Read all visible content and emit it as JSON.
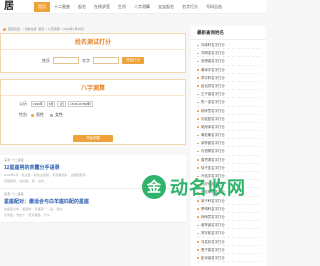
{
  "logo": {
    "text": "居"
  },
  "nav": {
    "items": [
      {
        "label": "首页",
        "active": true
      },
      {
        "label": "十二星座"
      },
      {
        "label": "起名"
      },
      {
        "label": "在线求签"
      },
      {
        "label": "生肖"
      },
      {
        "label": "八字测算"
      },
      {
        "label": "宝宝起名"
      },
      {
        "label": "名字打分"
      },
      {
        "label": "号码吉凶"
      }
    ]
  },
  "breadcrumb": {
    "label": "首页位置",
    "path": "> 当前位置: 首页 > 八字测算 > 2023年2月28日",
    "date": "2023年03月28日"
  },
  "name_test": {
    "title": "姓名测试打分",
    "surname_label": "姓氏",
    "name_label": "名字",
    "button": "开始打分"
  },
  "bazi": {
    "title": "八字测算",
    "date_label": "公历",
    "year": "1993年",
    "month": "5月",
    "day": "1日",
    "hour": "15:00-16:59(申)",
    "gender_label": "性别",
    "male": "男性",
    "female": "女性",
    "button": "开始测算"
  },
  "posts": [
    {
      "meta": "来源: 十二星座",
      "title": "12星座男的表露分手语录",
      "lines": [
        "2023年4月... 处女座... 和处女座相... 外观看起来... 这相知意思...",
        "巨蟹座男... 在外面... 我... 喜欢..."
      ]
    },
    {
      "meta": "来源: 十二星座",
      "title": "星座配对：最适合与白羊座匹配的星座",
      "lines": [
        "在星座之中... 星座时... 有星座一... 是... 通过...",
        "白羊座... 你这个... 配对星座... 什么..."
      ]
    }
  ],
  "sidebar": {
    "title": "最新查询姓名",
    "items": [
      "刘泽轩名字打分",
      "刘明浩名字打分",
      "张博涵名字打分",
      "黄泽宇名字打分",
      "李宇轩名字打分",
      "赵浩然名字打分",
      "王子涵名字打分",
      "陈一诺名字打分",
      "杨梓萱名字打分",
      "刘嘉懿名字打分",
      "吴雨泽名字打分",
      "黄若曦名字打分",
      "胡梓晨名字打分",
      "孙语桐名字打分",
      "周思源名字打分",
      "徐子墨名字打分",
      "许浩宇名字打分",
      "何欣怡名字打分",
      "马佳琪名字打分",
      "郭子轩名字打分",
      "罗明轩名字打分",
      "林雨萱名字打分",
      "谢梓涵名字打分",
      "郑宇航名字打分",
      "冯嘉欣名字打分",
      "曹子豪名字打分",
      "彭诗涵名字打分"
    ]
  },
  "watermark": {
    "icon": "金",
    "text": "动名收网"
  }
}
